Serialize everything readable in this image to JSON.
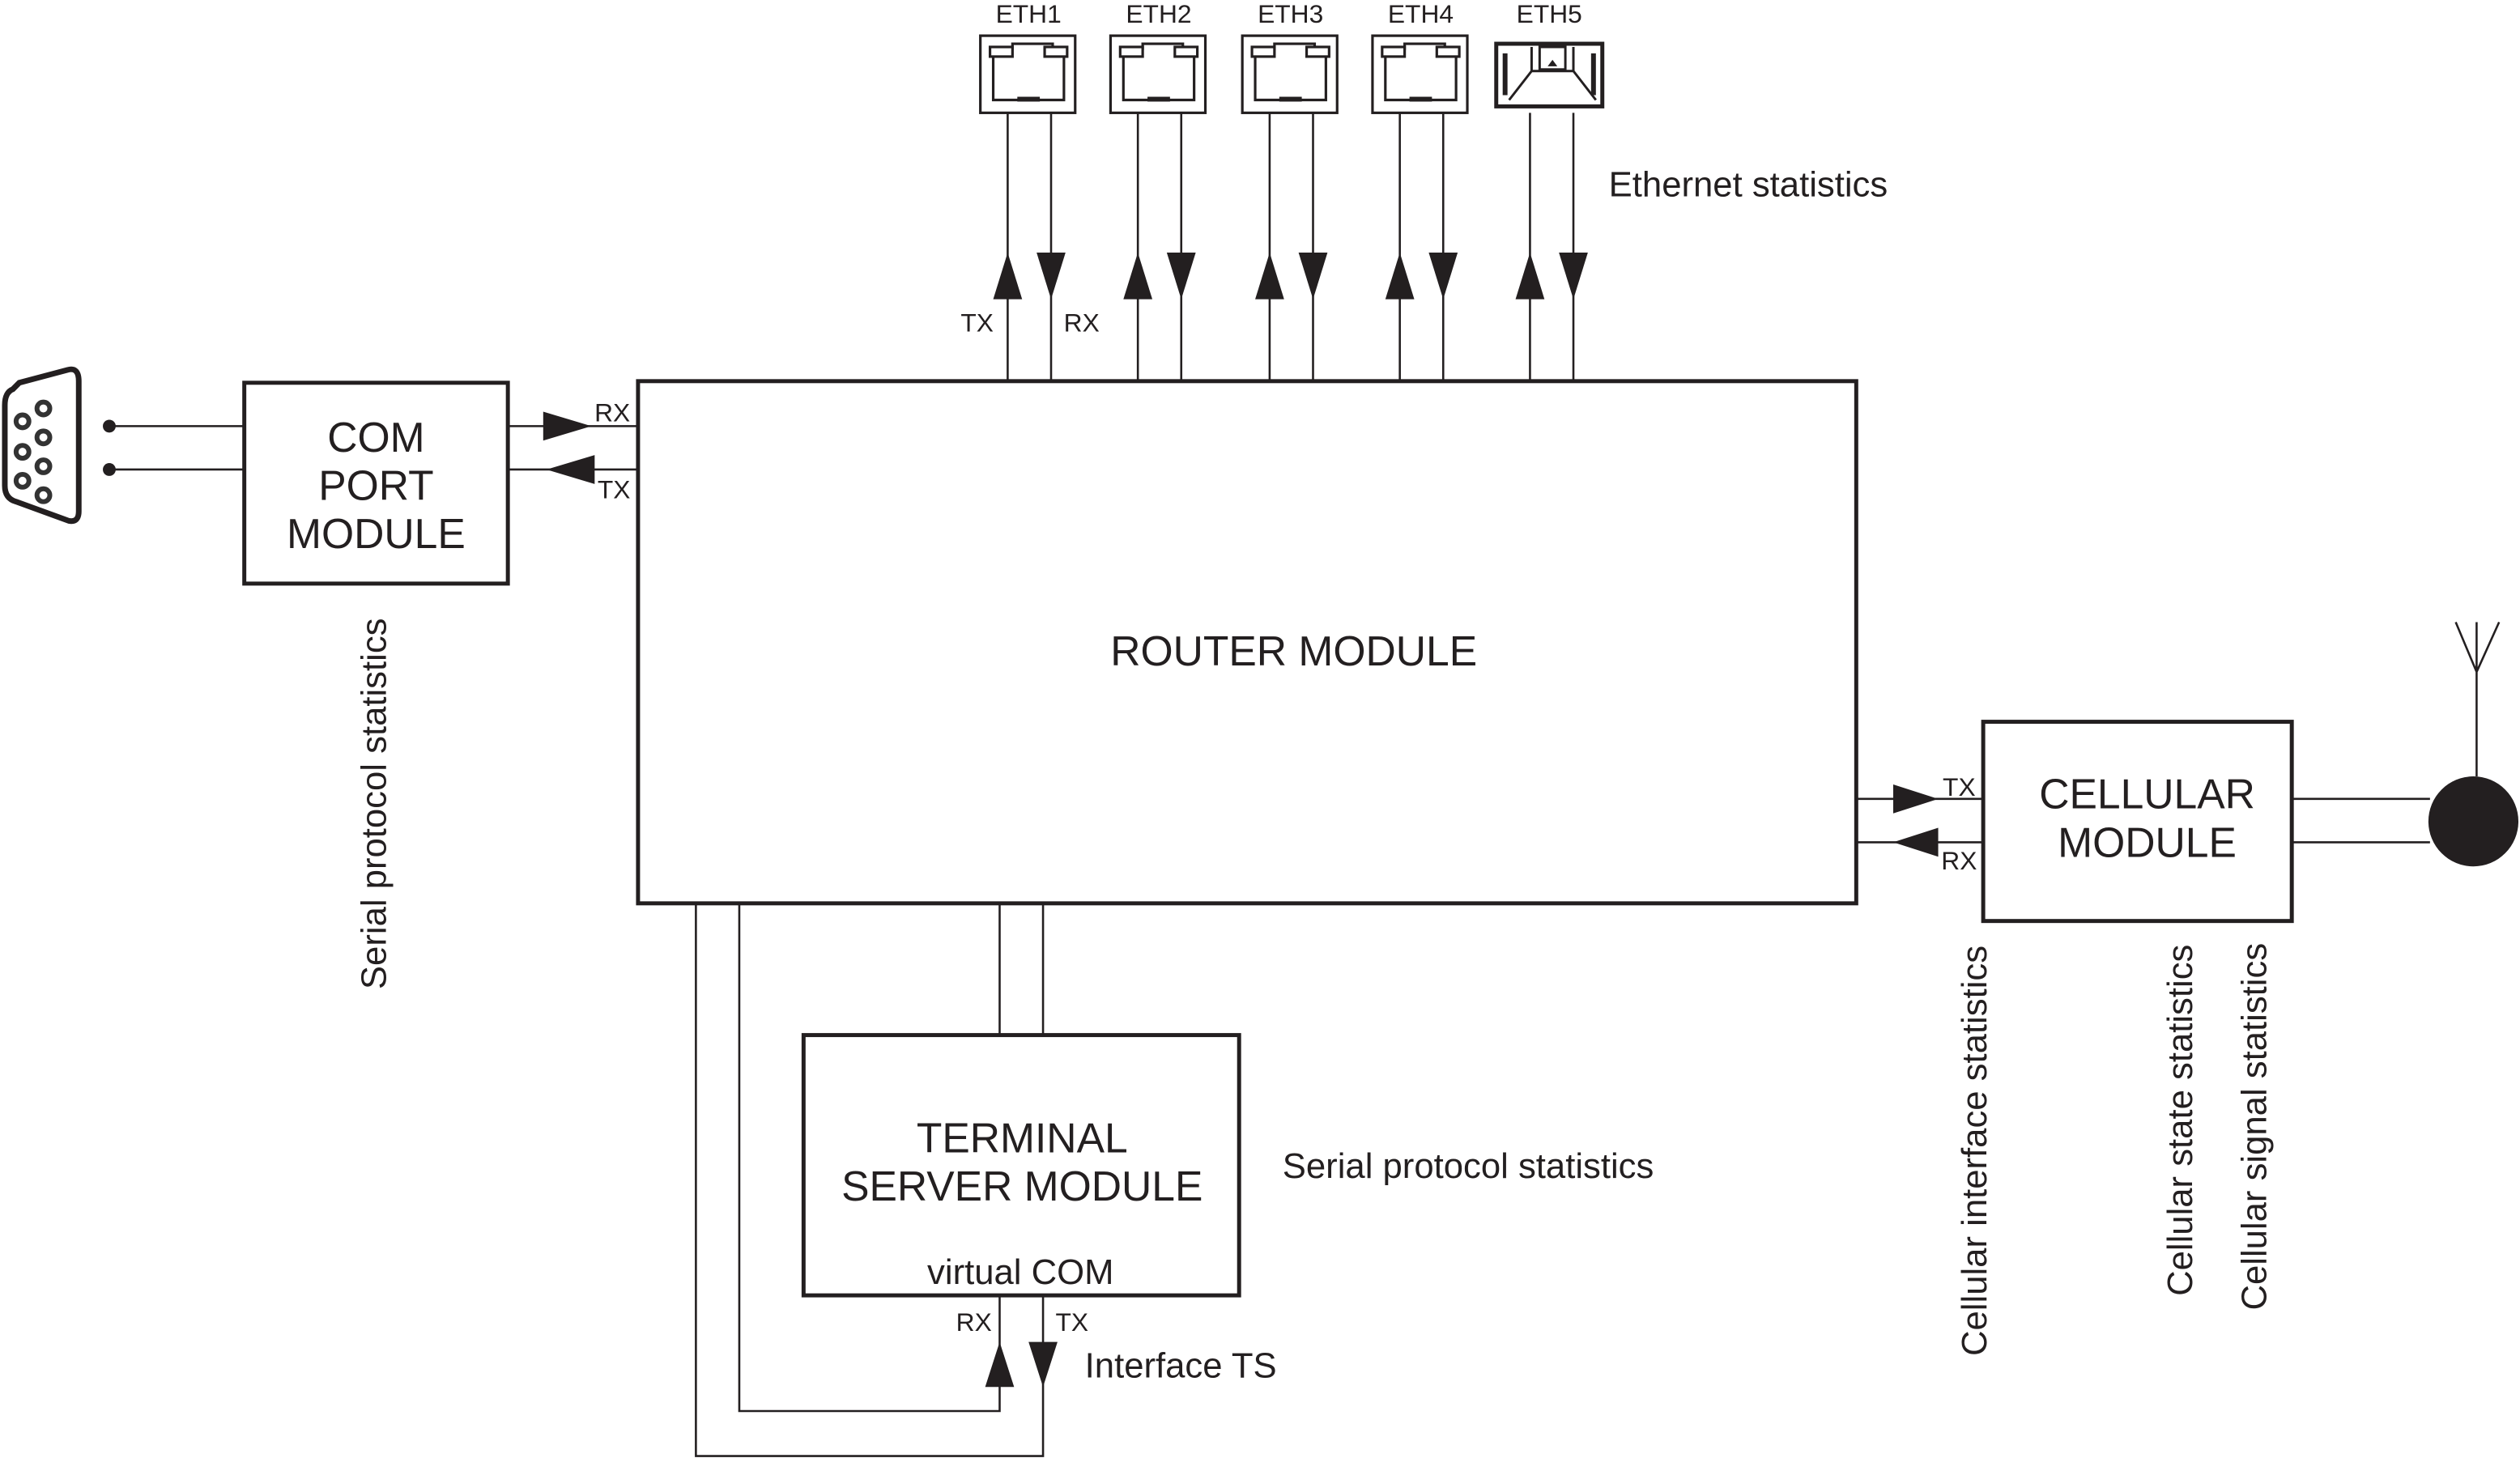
{
  "ethernet": {
    "ports": [
      {
        "label": "ETH1",
        "type": "rj45-icon"
      },
      {
        "label": "ETH2",
        "type": "rj45-icon"
      },
      {
        "label": "ETH3",
        "type": "rj45-icon"
      },
      {
        "label": "ETH4",
        "type": "rj45-icon"
      },
      {
        "label": "ETH5",
        "type": "sfp-icon"
      }
    ],
    "tx_label": "TX",
    "rx_label": "RX",
    "stats_label": "Ethernet statistics"
  },
  "router": {
    "label": "ROUTER MODULE"
  },
  "com_port": {
    "lines": [
      "COM",
      "PORT",
      "MODULE"
    ],
    "rx_label": "RX",
    "tx_label": "TX",
    "stats_label": "Serial protocol statistics",
    "connector_icon": "db9-connector-icon"
  },
  "cellular": {
    "lines": [
      "CELLULAR",
      "MODULE"
    ],
    "tx_label": "TX",
    "rx_label": "RX",
    "stats": [
      "Cellular interface statistics",
      "Cellular state statistics",
      "Cellular signal statistics"
    ],
    "antenna_icon": "antenna-icon"
  },
  "terminal_server": {
    "lines": [
      "TERMINAL",
      "SERVER MODULE"
    ],
    "sub_label": "virtual COM",
    "rx_label": "RX",
    "tx_label": "TX",
    "interface_label": "Interface TS",
    "stats_label": "Serial protocol statistics"
  }
}
